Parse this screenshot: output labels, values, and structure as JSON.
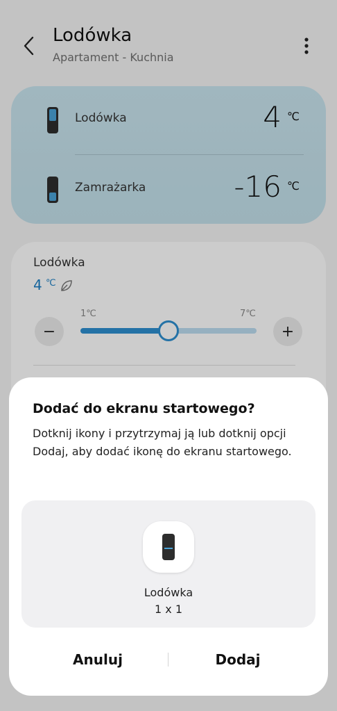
{
  "header": {
    "title": "Lodówka",
    "subtitle": "Apartament - Kuchnia",
    "back_icon": "chevron-left-icon",
    "more_icon": "more-vert-icon"
  },
  "temperatures": [
    {
      "label": "Lodówka",
      "value": "4",
      "unit": "℃",
      "icon": "fridge-icon"
    },
    {
      "label": "Zamrażarka",
      "value": "-16",
      "unit": "℃",
      "icon": "freezer-icon"
    }
  ],
  "control": {
    "title": "Lodówka",
    "current_value": "4",
    "unit": "℃",
    "eco_icon": "leaf-icon",
    "range_min": "1℃",
    "range_max": "7℃",
    "slider_level": 0.5,
    "minus_label": "−",
    "plus_label": "+"
  },
  "dialog": {
    "title": "Dodać do ekranu startowego?",
    "body": "Dotknij ikony i przytrzymaj ją lub dotknij opcji Dodaj, aby dodać ikonę do ekranu startowego.",
    "preview_name": "Lodówka",
    "preview_size": "1 x 1",
    "cancel_label": "Anuluj",
    "add_label": "Dodaj"
  },
  "colors": {
    "accent": "#2d8fd0",
    "temp_card": "#c9e5ef",
    "scrim": "rgba(0,0,0,0.2)"
  }
}
